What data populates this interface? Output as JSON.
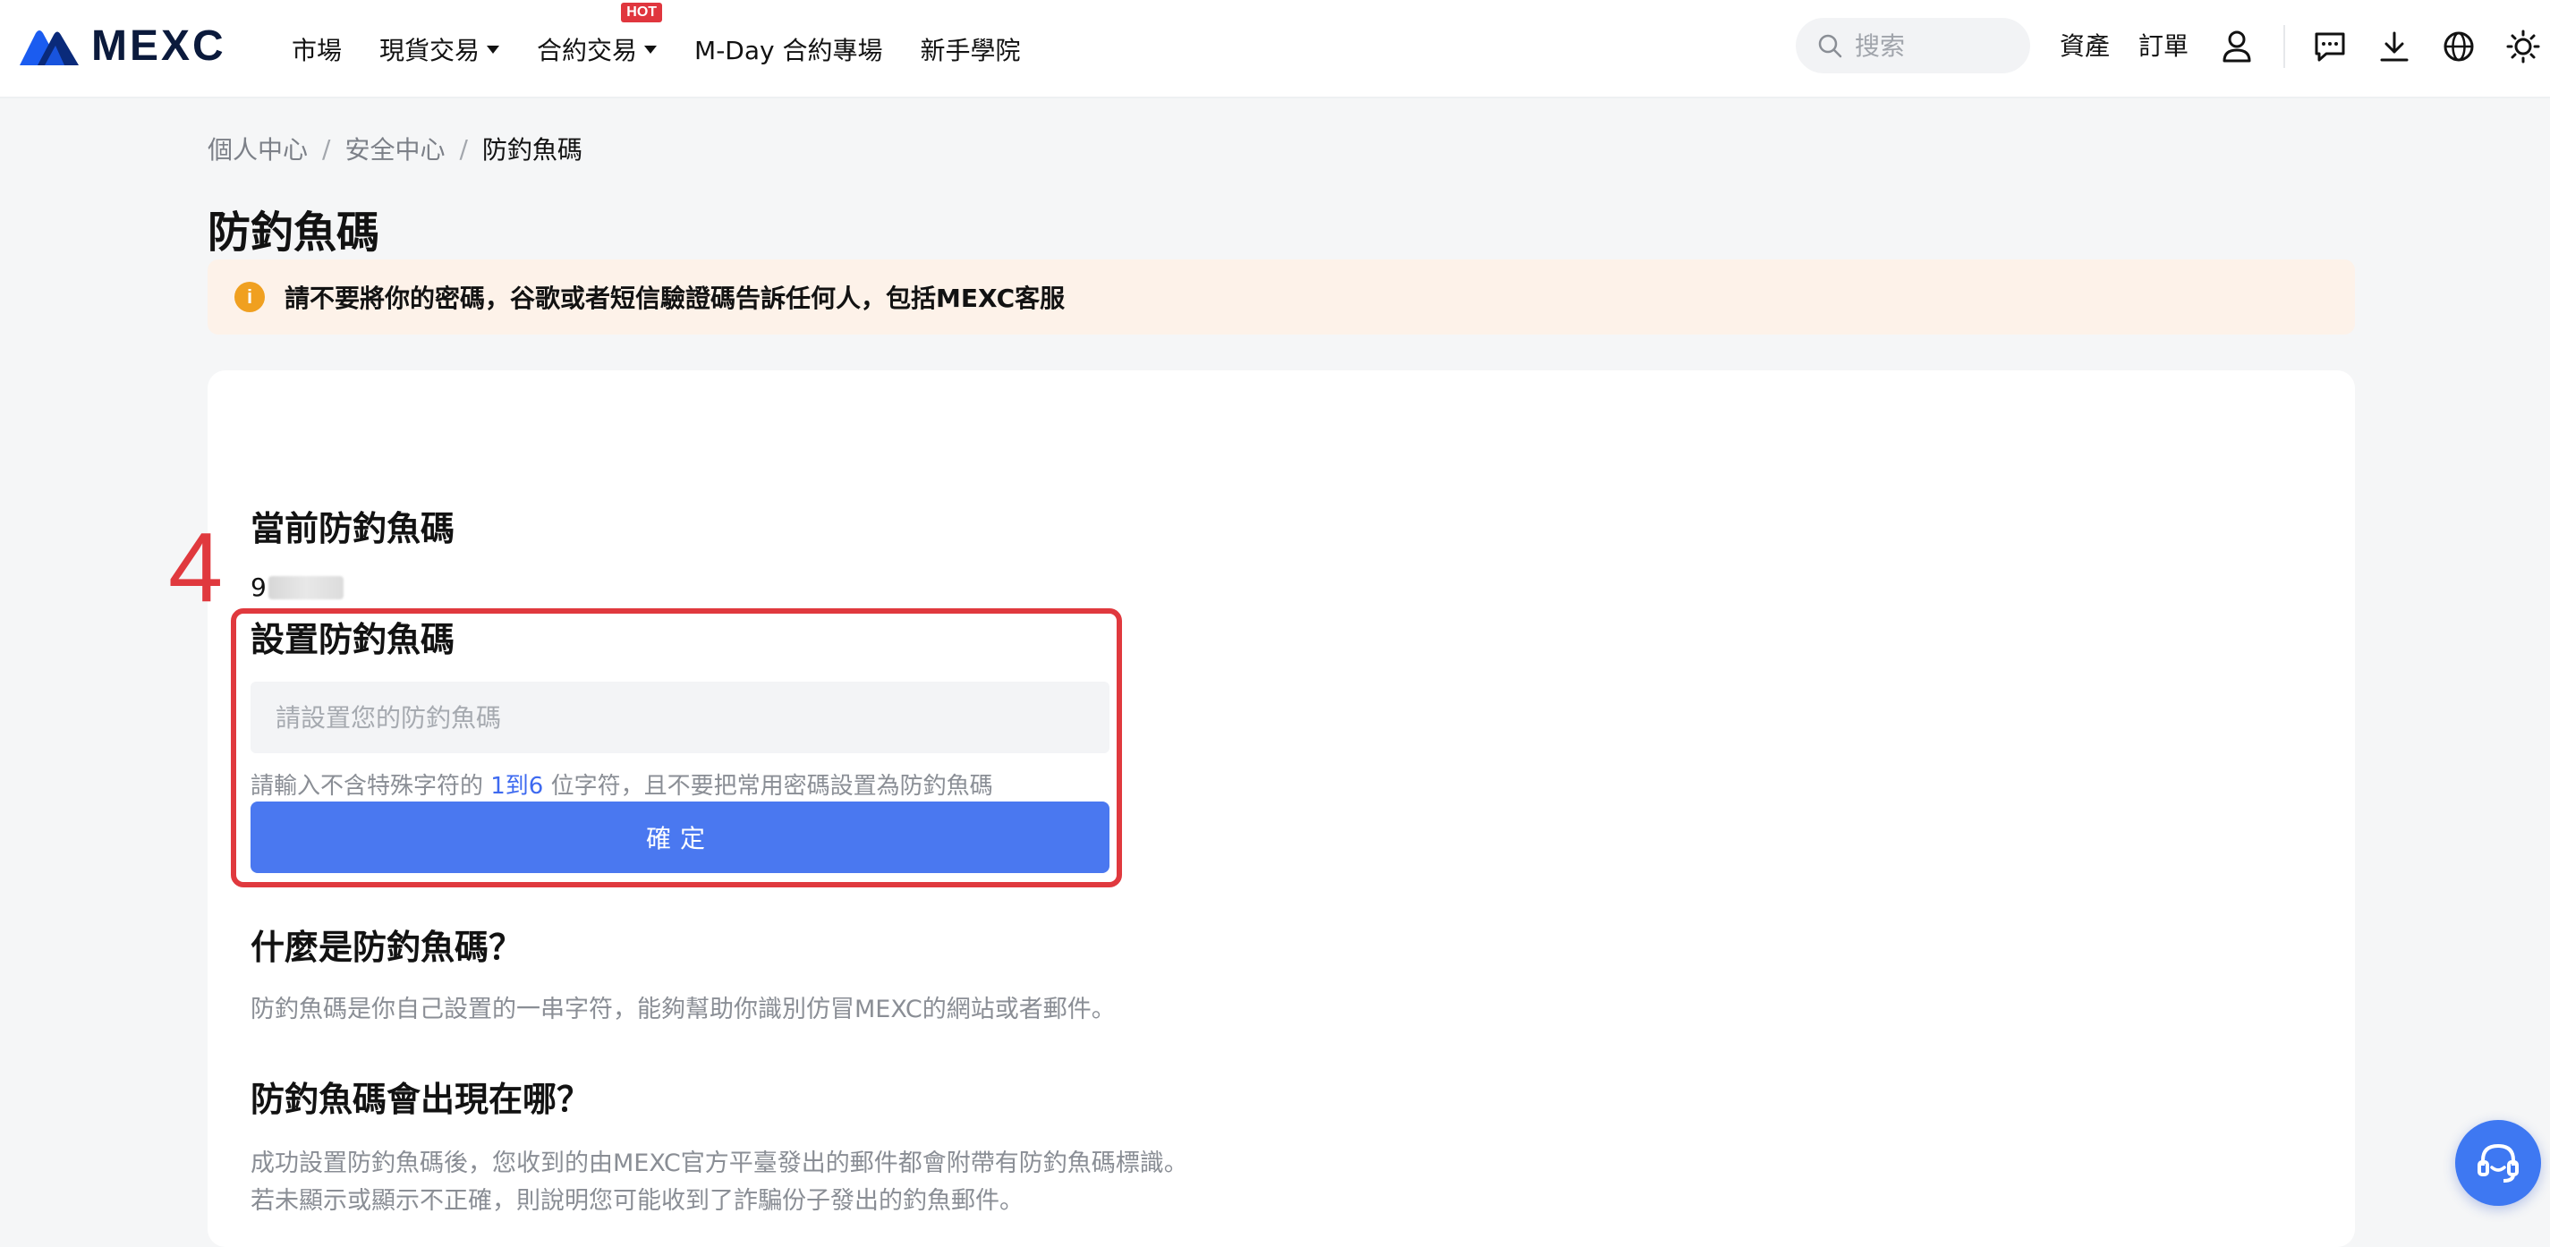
{
  "brand": {
    "name": "MEXC",
    "primary_color": "#4a78f0",
    "warning_bg": "#fdf2e9",
    "annotation_color": "#e0393e"
  },
  "nav": {
    "market": "市場",
    "spot": "現貨交易",
    "futures": "合約交易",
    "futures_badge": "HOT",
    "mday": "M-Day 合約專場",
    "academy": "新手學院"
  },
  "header": {
    "search_placeholder": "搜索",
    "assets": "資產",
    "orders": "訂單",
    "icons": [
      "user-icon",
      "message-icon",
      "download-icon",
      "globe-icon",
      "theme-sun-icon"
    ]
  },
  "breadcrumb": {
    "items": [
      "個人中心",
      "安全中心",
      "防釣魚碼"
    ],
    "separator": "/"
  },
  "page": {
    "title": "防釣魚碼",
    "warning": "請不要將你的密碼，谷歌或者短信驗證碼告訴任何人，包括MEXC客服",
    "warning_icon_glyph": "i"
  },
  "current": {
    "title": "當前防釣魚碼",
    "code_visible": "9"
  },
  "annotation": {
    "step": "4"
  },
  "setup": {
    "title": "設置防釣魚碼",
    "placeholder": "請設置您的防釣魚碼",
    "hint_prefix": "請輸入不含特殊字符的 ",
    "hint_range": "1到6",
    "hint_suffix": " 位字符，且不要把常用密碼設置為防釣魚碼",
    "confirm": "確定"
  },
  "faq": {
    "what_title": "什麼是防釣魚碼？",
    "what_text": "防釣魚碼是你自己設置的一串字符，能夠幫助你識別仿冒MEXC的網站或者郵件。",
    "where_title": "防釣魚碼會出現在哪？",
    "where_text_1": "成功設置防釣魚碼後，您收到的由MEXC官方平臺發出的郵件都會附帶有防釣魚碼標識。",
    "where_text_2": "若未顯示或顯示不正確，則說明您可能收到了詐騙份子發出的釣魚郵件。"
  }
}
